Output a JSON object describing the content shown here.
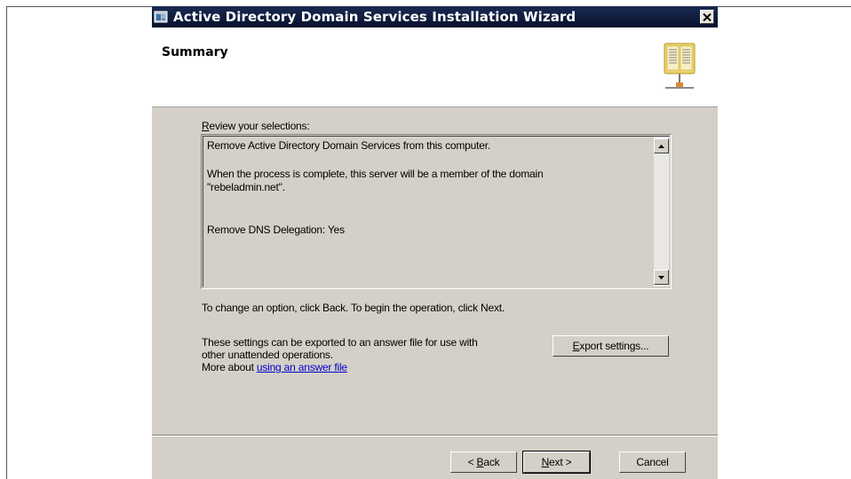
{
  "window": {
    "title": "Active Directory Domain Services Installation Wizard",
    "close_glyph": "✕"
  },
  "header": {
    "heading": "Summary"
  },
  "review": {
    "label_accel": "R",
    "label_rest": "eview your selections:",
    "lines": [
      "Remove Active Directory Domain Services from this computer.",
      "When the process is complete, this server will be a member of the domain",
      "\"rebeladmin.net\".",
      "Remove DNS Delegation: Yes"
    ]
  },
  "instruction": "To change an option, click Back. To begin the operation, click Next.",
  "export": {
    "text_line1": "These settings can be exported to an answer file for use with",
    "text_line2": "other unattended operations.",
    "more_prefix": "More about ",
    "link_text": "using an answer file",
    "button_accel": "E",
    "button_rest": "xport settings..."
  },
  "buttons": {
    "back_prefix": "< ",
    "back_accel": "B",
    "back_rest": "ack",
    "next_prefix": "",
    "next_accel": "N",
    "next_rest": "ext >",
    "cancel": "Cancel"
  },
  "icons": {
    "app": "ad-wizard-icon",
    "header": "open-book-icon",
    "close": "close-icon",
    "scroll_up": "scroll-up-arrow-icon",
    "scroll_down": "scroll-down-arrow-icon"
  },
  "colors": {
    "titlebar": "#0b1a3e",
    "dialog_bg": "#d4d0c8",
    "link": "#0000cc"
  }
}
